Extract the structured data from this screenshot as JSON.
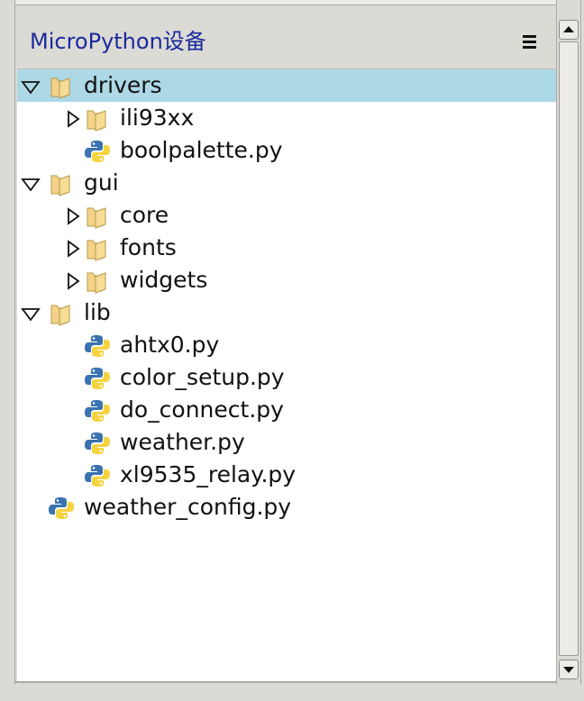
{
  "panel": {
    "title": "MicroPython设备",
    "menu_icon": "hamburger-menu-icon"
  },
  "tree": {
    "selected_index": 0,
    "items": [
      {
        "label": "drivers",
        "type": "folder",
        "depth": 0,
        "expanded": true
      },
      {
        "label": "ili93xx",
        "type": "folder",
        "depth": 1,
        "expanded": false
      },
      {
        "label": "boolpalette.py",
        "type": "python-file",
        "depth": 1
      },
      {
        "label": "gui",
        "type": "folder",
        "depth": 0,
        "expanded": true
      },
      {
        "label": "core",
        "type": "folder",
        "depth": 1,
        "expanded": false
      },
      {
        "label": "fonts",
        "type": "folder",
        "depth": 1,
        "expanded": false
      },
      {
        "label": "widgets",
        "type": "folder",
        "depth": 1,
        "expanded": false
      },
      {
        "label": "lib",
        "type": "folder",
        "depth": 0,
        "expanded": true
      },
      {
        "label": "ahtx0.py",
        "type": "python-file",
        "depth": 1
      },
      {
        "label": "color_setup.py",
        "type": "python-file",
        "depth": 1
      },
      {
        "label": "do_connect.py",
        "type": "python-file",
        "depth": 1
      },
      {
        "label": "weather.py",
        "type": "python-file",
        "depth": 1
      },
      {
        "label": "xl9535_relay.py",
        "type": "python-file",
        "depth": 1
      },
      {
        "label": "weather_config.py",
        "type": "python-file",
        "depth": 0
      }
    ]
  },
  "colors": {
    "title": "#1a2a9c",
    "selection": "#add8e6",
    "folder": "#f3d38a",
    "python_blue": "#3a73b0",
    "python_yellow": "#f5d33f"
  }
}
